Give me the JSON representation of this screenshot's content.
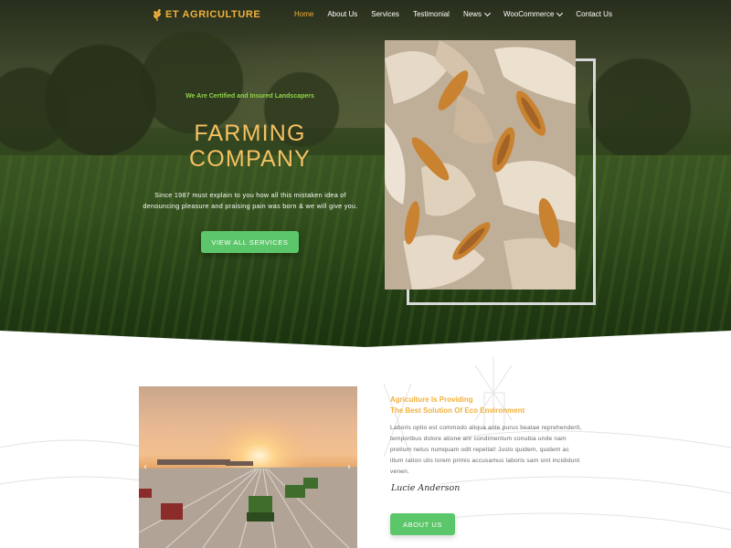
{
  "nav": {
    "logo_text": "ET AGRICULTURE",
    "items": [
      {
        "label": "Home",
        "active": true,
        "dropdown": false
      },
      {
        "label": "About Us",
        "active": false,
        "dropdown": false
      },
      {
        "label": "Services",
        "active": false,
        "dropdown": false
      },
      {
        "label": "Testimonial",
        "active": false,
        "dropdown": false
      },
      {
        "label": "News",
        "active": false,
        "dropdown": true
      },
      {
        "label": "WooCommerce",
        "active": false,
        "dropdown": true
      },
      {
        "label": "Contact Us",
        "active": false,
        "dropdown": false
      }
    ]
  },
  "hero": {
    "certified": "We Are Certified and Insured Landscapers",
    "title_line1": "FARMING",
    "title_line2": "COMPANY",
    "desc_line1": "Since 1987 must explain to you how all this mistaken idea of",
    "desc_line2": "denouncing pleasure and praising pain was born & we will give you.",
    "cta_label": "VIEW ALL SERVICES"
  },
  "about": {
    "heading_line1": "Agriculture Is Providing",
    "heading_line2": "The Best Solution Of Eco Environment",
    "body_lines": [
      "Laboris optio est commodo aliqua ante purus beatae reprehenderit,",
      "temporibus dolore atione anr condimentum conubia unde nam",
      "pretium  netus numquam odit repellat! Justo quidem, quidem ac",
      "illum ration ulis lorem primis accusamus laboris sam sint incididunt",
      "venen."
    ],
    "signature": "Lucie Anderson",
    "cta_label": "ABOUT US"
  },
  "slider": {
    "prev_icon": "chevron-left-icon",
    "next_icon": "chevron-right-icon"
  },
  "colors": {
    "accent_gold": "#f2b13a",
    "accent_green": "#5cc76a",
    "certified_green": "#8fd64a"
  }
}
